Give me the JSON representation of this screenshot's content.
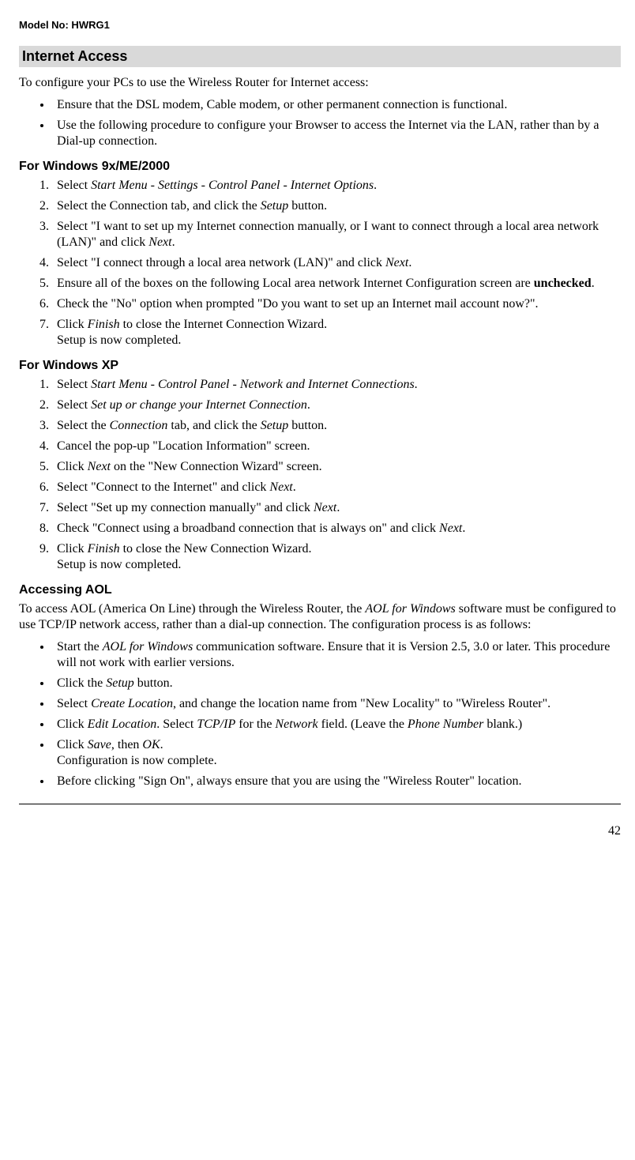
{
  "header": {
    "model": "Model No: HWRG1"
  },
  "section": {
    "title": "Internet Access",
    "intro": "To configure your PCs to use the Wireless Router for Internet access:",
    "bullets": [
      "Ensure that the DSL modem, Cable modem, or other permanent connection is functional.",
      "Use the following procedure to configure your Browser to access the Internet via the LAN, rather than by a Dial-up connection."
    ]
  },
  "win9x": {
    "title": "For Windows 9x/ME/2000",
    "steps": [
      {
        "pre": "Select ",
        "it": "Start Menu - Settings - Control Panel - Internet Options",
        "post": "."
      },
      {
        "pre": "Select the Connection tab, and click the ",
        "it": "Setup",
        "post": " button."
      },
      {
        "pre": "Select \"I want to set up my Internet connection manually, or I want to connect through a local area network (LAN)\" and click ",
        "it": "Next",
        "post": "."
      },
      {
        "pre": "Select \"I connect through a local area network (LAN)\" and click ",
        "it": "Next",
        "post": "."
      },
      {
        "pre": "Ensure all of the boxes on the following Local area network Internet Configuration screen are ",
        "b": "unchecked",
        "post": "."
      },
      {
        "pre": "Check the \"No\" option when prompted \"Do you want to set up an Internet mail account now?\".",
        "it": "",
        "post": ""
      },
      {
        "pre": "Click ",
        "it": "Finish",
        "post": " to close the Internet Connection Wizard.",
        "br": "Setup is now completed."
      }
    ]
  },
  "winxp": {
    "title": "For Windows XP",
    "steps": [
      {
        "pre": "Select ",
        "it": "Start Menu - Control Panel - Network and Internet Connections",
        "post": "."
      },
      {
        "pre": "Select ",
        "it": "Set up or change your Internet Connection",
        "post": "."
      },
      {
        "pre": "Select the ",
        "it": "Connection",
        "post": " tab, and click the ",
        "it2": "Setup",
        "post2": " button."
      },
      {
        "pre": "Cancel the pop-up \"Location Information\" screen."
      },
      {
        "pre": "Click ",
        "it": "Next",
        "post": " on the \"New Connection Wizard\" screen."
      },
      {
        "pre": "Select \"Connect to the Internet\" and click ",
        "it": "Next",
        "post": "."
      },
      {
        "pre": "Select \"Set up my connection manually\" and click ",
        "it": "Next",
        "post": "."
      },
      {
        "pre": "Check \"Connect using a broadband connection that is always on\" and click ",
        "it": "Next",
        "post": "."
      },
      {
        "pre": "Click ",
        "it": "Finish",
        "post": " to close the New Connection Wizard.",
        "br": "Setup is now completed."
      }
    ]
  },
  "aol": {
    "title": "Accessing AOL",
    "intro_pre": "To access AOL (America On Line) through the Wireless Router, the ",
    "intro_it": "AOL for Windows",
    "intro_post": " software must be configured to use TCP/IP network access, rather than a dial-up connection. The configuration process is as follows:",
    "bullets": [
      {
        "pre": "Start the ",
        "it": "AOL for Windows",
        "post": " communication software. Ensure that it is Version 2.5, 3.0 or later. This procedure will not work with earlier versions."
      },
      {
        "pre": "Click the ",
        "it": "Setup",
        "post": " button."
      },
      {
        "pre": "Select ",
        "it": "Create Location",
        "post": ", and change the location name from \"New Locality\" to \"Wireless Router\"."
      },
      {
        "pre": "Click ",
        "it": "Edit Location",
        "post": ". Select ",
        "it2": "TCP/IP",
        "post2": " for the ",
        "it3": "Network",
        "post3": " field. (Leave the ",
        "it4": "Phone Number",
        "post4": " blank.)"
      },
      {
        "pre": "Click ",
        "it": "Save",
        "post": ", then ",
        "it2": "OK",
        "post2": ".",
        "br": "Configuration is now complete."
      },
      {
        "pre": "Before clicking \"Sign On\", always ensure that you are using the \"Wireless Router\" location."
      }
    ]
  },
  "footer": {
    "page": "42"
  }
}
